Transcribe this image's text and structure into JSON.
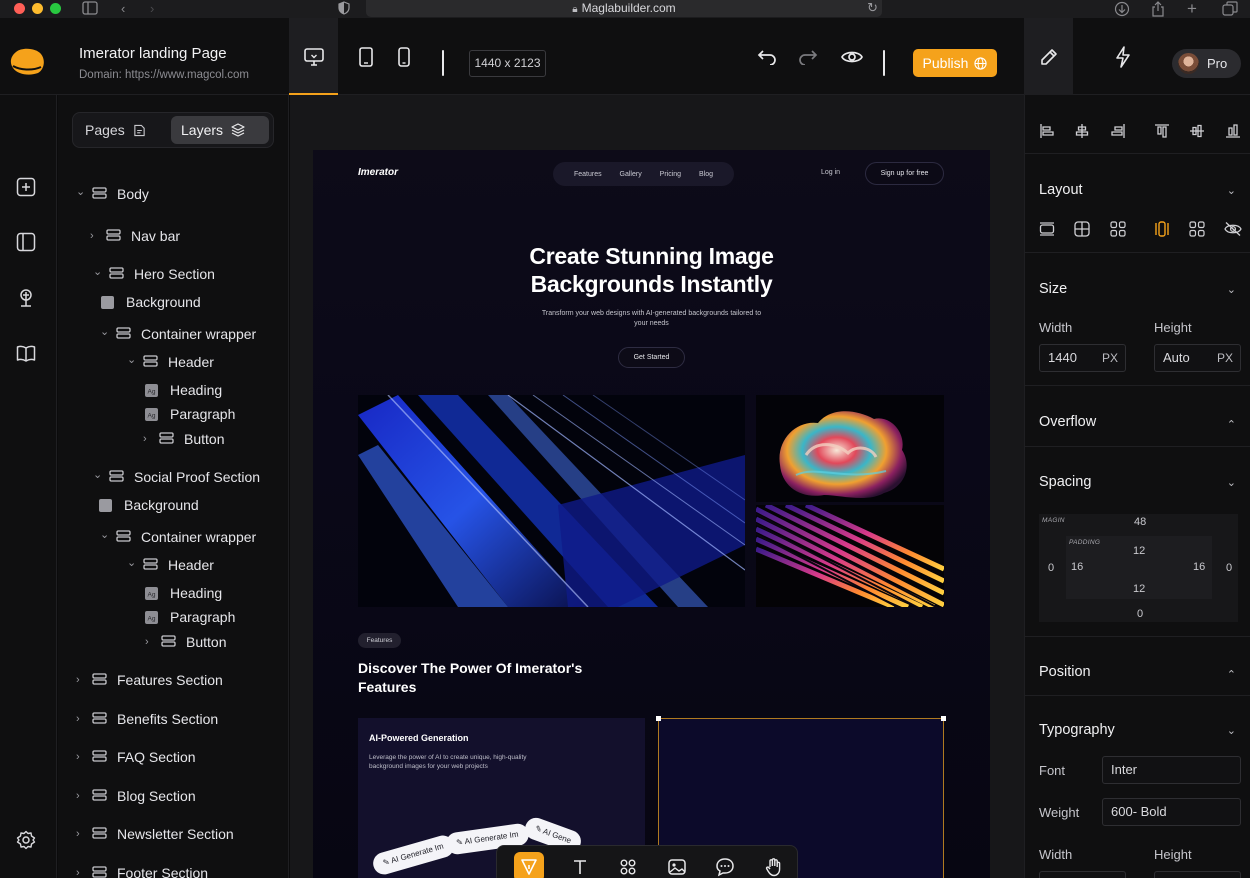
{
  "browser": {
    "url": "Maglabuilder.com"
  },
  "app": {
    "project_title": "Imerator landing Page",
    "project_domain": "Domain: https://www.magcol.com",
    "canvas_size": "1440 x 2123",
    "publish_label": "Publish",
    "plan_label": "Pro",
    "accent_color": "#f5a21b"
  },
  "left_panel": {
    "tabs": [
      {
        "label": "Pages"
      },
      {
        "label": "Layers"
      }
    ],
    "active_tab": "Layers",
    "tree": [
      {
        "label": "Body",
        "type": "layer",
        "expanded": true
      },
      {
        "label": "Nav bar",
        "type": "layer",
        "expanded": false
      },
      {
        "label": "Hero Section",
        "type": "layer",
        "expanded": true
      },
      {
        "label": "Background",
        "type": "fill"
      },
      {
        "label": "Container wrapper",
        "type": "layer",
        "expanded": true
      },
      {
        "label": "Header",
        "type": "layer",
        "expanded": true
      },
      {
        "label": "Heading",
        "type": "text"
      },
      {
        "label": "Paragraph",
        "type": "text"
      },
      {
        "label": "Button",
        "type": "layer",
        "expanded": false
      },
      {
        "label": "Social Proof Section",
        "type": "layer",
        "expanded": true
      },
      {
        "label": "Background",
        "type": "fill"
      },
      {
        "label": "Container wrapper",
        "type": "layer",
        "expanded": true
      },
      {
        "label": "Header",
        "type": "layer",
        "expanded": true
      },
      {
        "label": "Heading",
        "type": "text"
      },
      {
        "label": "Paragraph",
        "type": "text"
      },
      {
        "label": "Button",
        "type": "layer",
        "expanded": false
      },
      {
        "label": "Features Section",
        "type": "layer",
        "expanded": false
      },
      {
        "label": "Benefits Section",
        "type": "layer",
        "expanded": false
      },
      {
        "label": "FAQ Section",
        "type": "layer",
        "expanded": false
      },
      {
        "label": "Blog Section",
        "type": "layer",
        "expanded": false
      },
      {
        "label": "Newsletter Section",
        "type": "layer",
        "expanded": false
      },
      {
        "label": "Footer Section",
        "type": "layer",
        "expanded": false
      }
    ]
  },
  "preview": {
    "logo": "Imerator",
    "nav": [
      "Features",
      "Gallery",
      "Pricing",
      "Blog"
    ],
    "login": "Log in",
    "signup": "Sign up for free",
    "hero_title_line1": "Create Stunning Image",
    "hero_title_line2": "Backgrounds Instantly",
    "hero_sub": "Transform your web designs with AI-generated backgrounds tailored to your needs",
    "cta": "Get Started",
    "features_pill": "Features",
    "features_title": "Discover The Power Of Imerator's Features",
    "card_title": "AI-Powered Generation",
    "card_desc": "Leverage the power of AI to create unique, high-quality background images for your web projects",
    "chips": [
      "AI Generate Im",
      "AI Generate Im",
      "AI Gene"
    ]
  },
  "inspector": {
    "sections": {
      "layout": "Layout",
      "size": "Size",
      "overflow": "Overflow",
      "spacing": "Spacing",
      "position": "Position",
      "typography": "Typography"
    },
    "size": {
      "width_label": "Width",
      "width_value": "1440",
      "width_unit": "PX",
      "height_label": "Height",
      "height_value": "Auto",
      "height_unit": "PX"
    },
    "spacing": {
      "margin_label": "MAGIN",
      "padding_label": "PADDING",
      "margin_top": "48",
      "margin_left": "0",
      "margin_right": "0",
      "margin_bottom": "0",
      "padding_top": "12",
      "padding_left": "16",
      "padding_right": "16",
      "padding_bottom": "12"
    },
    "typography": {
      "font_label": "Font",
      "font_value": "Inter",
      "weight_label": "Weight",
      "weight_value": "600- Bold",
      "width_label": "Width",
      "height_label": "Height"
    }
  }
}
